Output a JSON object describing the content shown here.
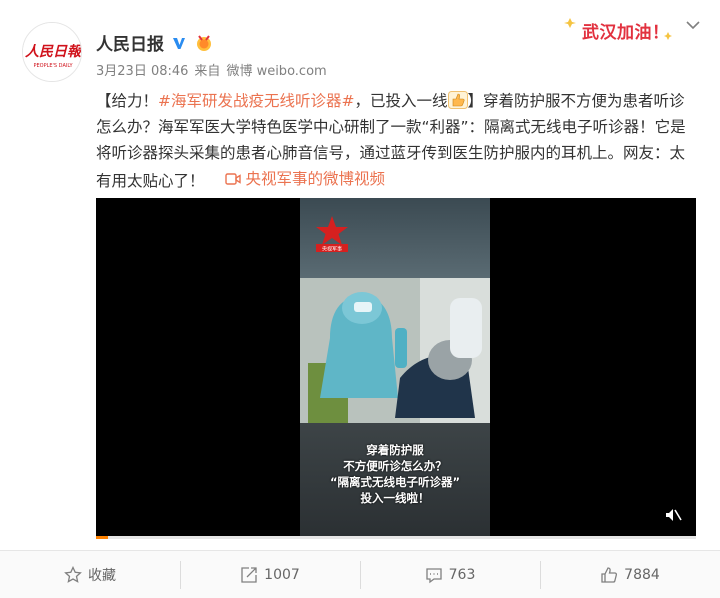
{
  "header": {
    "author_name": "人民日报",
    "avatar_logo_text": "人民日报",
    "avatar_logo_sub": "PEOPLE'S DAILY",
    "date": "3月23日 08:46",
    "source_prefix": "来自",
    "source": "微博 weibo.com",
    "campaign_label": "武汉加油！",
    "icons": [
      "verified-v-icon",
      "medal-icon",
      "chevron-down-icon"
    ]
  },
  "post": {
    "bracket_open": "【给力！",
    "hashtag": "#海军研发战疫无线听诊器#",
    "after_hashtag": "，已投入一线",
    "after_emoji": "】穿着防护服不方便为患者听诊怎么办？海军军医大学特色医学中心研制了一款“利器”：隔离式无线电子听诊器！它是将听诊器探头采集的患者心肺音信号，通过蓝牙传到医生防护服内的耳机上。网友：太有用太贴心了！",
    "video_link_label": "央视军事的微博视频"
  },
  "video": {
    "caption_line1": "穿着防护服",
    "caption_line2": "不方便听诊怎么办？",
    "caption_line3": "“隔离式无线电子听诊器”",
    "caption_line4": "投入一线啦！",
    "channel_logo_text": "央视军事",
    "progress_fraction": 0.02
  },
  "actions": {
    "favorite_label": "收藏",
    "repost_count": "1007",
    "comment_count": "763",
    "like_count": "7884"
  },
  "colors": {
    "link": "#eb7350",
    "campaign": "#e2313f",
    "verify": "#2a8cf0"
  }
}
